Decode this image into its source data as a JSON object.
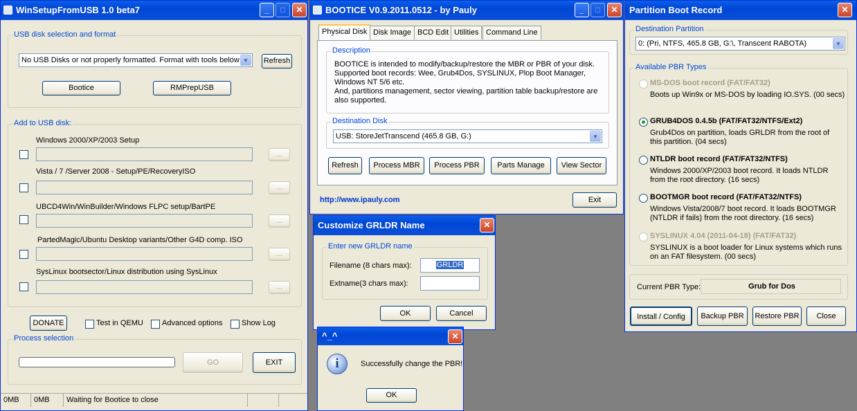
{
  "winsetup": {
    "title": "WinSetupFromUSB 1.0 beta7",
    "usb_group": "USB disk selection and format",
    "usb_select": "No USB Disks or not properly formatted. Format with tools below",
    "refresh": "Refresh",
    "bootice": "Bootice",
    "rmprep": "RMPrepUSB",
    "add_group": "Add to USB disk:",
    "items": [
      {
        "label": "Windows 2000/XP/2003 Setup"
      },
      {
        "label": "Vista / 7 /Server 2008 - Setup/PE/RecoveryISO"
      },
      {
        "label": "UBCD4Win/WinBuilder/Windows FLPC setup/BartPE"
      },
      {
        "label": "PartedMagic/Ubuntu Desktop variants/Other G4D comp. ISO"
      },
      {
        "label": "SysLinux bootsector/Linux distribution using SysLinux"
      }
    ],
    "browse": "...",
    "donate": "DONATE",
    "test_qemu": "Test in QEMU",
    "advanced": "Advanced options",
    "show_log": "Show Log",
    "process_group": "Process selection",
    "go": "GO",
    "exit": "EXIT",
    "status": [
      "0MB",
      "0MB",
      "Waiting for Bootice to close"
    ]
  },
  "bootice": {
    "title": "BOOTICE V0.9.2011.0512 - by Pauly",
    "tabs": [
      "Physical Disk",
      "Disk Image",
      "BCD Edit",
      "Utilities",
      "Command Line"
    ],
    "desc_group": "Description",
    "desc_lines": [
      "BOOTICE is intended to modify/backup/restore the MBR or PBR of your disk.",
      "Supported boot records: Wee, Grub4Dos, SYSLINUX, Plop Boot Manager,",
      "Windows NT 5/6 etc.",
      "And, partitions management, sector viewing, partition table backup/restore are",
      "also supported."
    ],
    "dest_group": "Destination Disk",
    "dest_value": "USB: StoreJetTranscend (465.8 GB, G:)",
    "buttons": [
      "Refresh",
      "Process MBR",
      "Process PBR",
      "Parts Manage",
      "View Sector"
    ],
    "link": "http://www.ipauly.com",
    "exit": "Exit"
  },
  "pbr": {
    "title": "Partition Boot Record",
    "dest_group": "Destination Partition",
    "dest_value": "0: (Pri,  NTFS, 465.8 GB, G:\\, Transcent RABOTA)",
    "types_group": "Available PBR Types",
    "types": [
      {
        "title": "MS-DOS boot record (FAT/FAT32)",
        "desc1": "Boots up Win9x or MS-DOS by loading IO.SYS. (00 secs)",
        "desc2": ""
      },
      {
        "title": "GRUB4DOS 0.4.5b (FAT/FAT32/NTFS/Ext2)",
        "desc1": "Grub4Dos on partition, loads GRLDR from the root of",
        "desc2": "this partition. (04 secs)"
      },
      {
        "title": "NTLDR boot record (FAT/FAT32/NTFS)",
        "desc1": "Windows 2000/XP/2003 boot record. It loads NTLDR",
        "desc2": "from the root directory. (16 secs)"
      },
      {
        "title": "BOOTMGR boot record (FAT/FAT32/NTFS)",
        "desc1": "Windows Vista/2008/7 boot record. It loads BOOTMGR",
        "desc2": "(NTLDR if fails) from the root directory. (16 secs)"
      },
      {
        "title": "SYSLINUX 4.04 (2011-04-18) (FAT/FAT32)",
        "desc1": "SYSLINUX is a boot loader for Linux systems which runs",
        "desc2": "on an FAT filesystem. (00 secs)"
      }
    ],
    "current_label": "Current PBR Type:",
    "current_value": "Grub for Dos",
    "install": "Install / Config",
    "backup": "Backup PBR",
    "restore": "Restore PBR",
    "close": "Close"
  },
  "grldr": {
    "title": "Customize GRLDR Name",
    "group": "Enter new GRLDR name",
    "filename_label": "Filename (8 chars max):",
    "filename_value": "GRLDR",
    "extname_label": "Extname(3 chars max):",
    "extname_value": "",
    "ok": "OK",
    "cancel": "Cancel"
  },
  "msg": {
    "title": "^_^",
    "text": "Successfully change the PBR!",
    "ok": "OK"
  }
}
